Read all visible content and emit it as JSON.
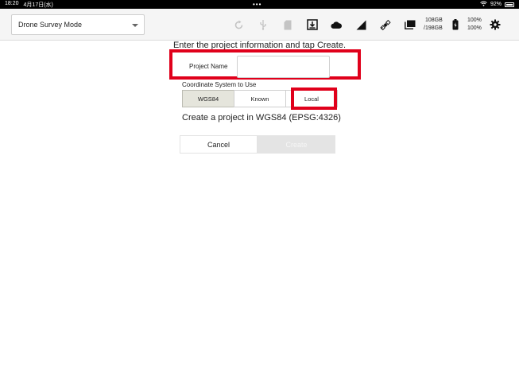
{
  "statusbar": {
    "time": "18:20",
    "date": "4月17日(水)",
    "center_dots": "•••",
    "battery_percent": "92%"
  },
  "toolbar": {
    "mode_select": "Drone Survey Mode",
    "storage_line1": "108GB",
    "storage_line2": "/198GB",
    "battery_line1": "100%",
    "battery_line2": "100%",
    "icons": [
      "refresh-icon",
      "usb-icon",
      "sd-card-icon",
      "download-icon",
      "cloud-icon",
      "signal-icon",
      "satellite-icon",
      "folder-icon",
      "battery-icon",
      "gear-icon"
    ]
  },
  "form": {
    "prompt": "Enter the project information and tap Create.",
    "project_name_label": "Project Name",
    "project_name_value": "",
    "coord_system_label": "Coordinate System to Use",
    "segments": [
      "WGS84",
      "Known",
      "Local"
    ],
    "selected_segment": "WGS84",
    "info": "Create a project in WGS84 (EPSG:4326)",
    "cancel_label": "Cancel",
    "create_label": "Create"
  },
  "colors": {
    "highlight": "#e0001b",
    "toolbar_bg": "#f5f5f5",
    "selected_seg": "#e5e5dc"
  }
}
